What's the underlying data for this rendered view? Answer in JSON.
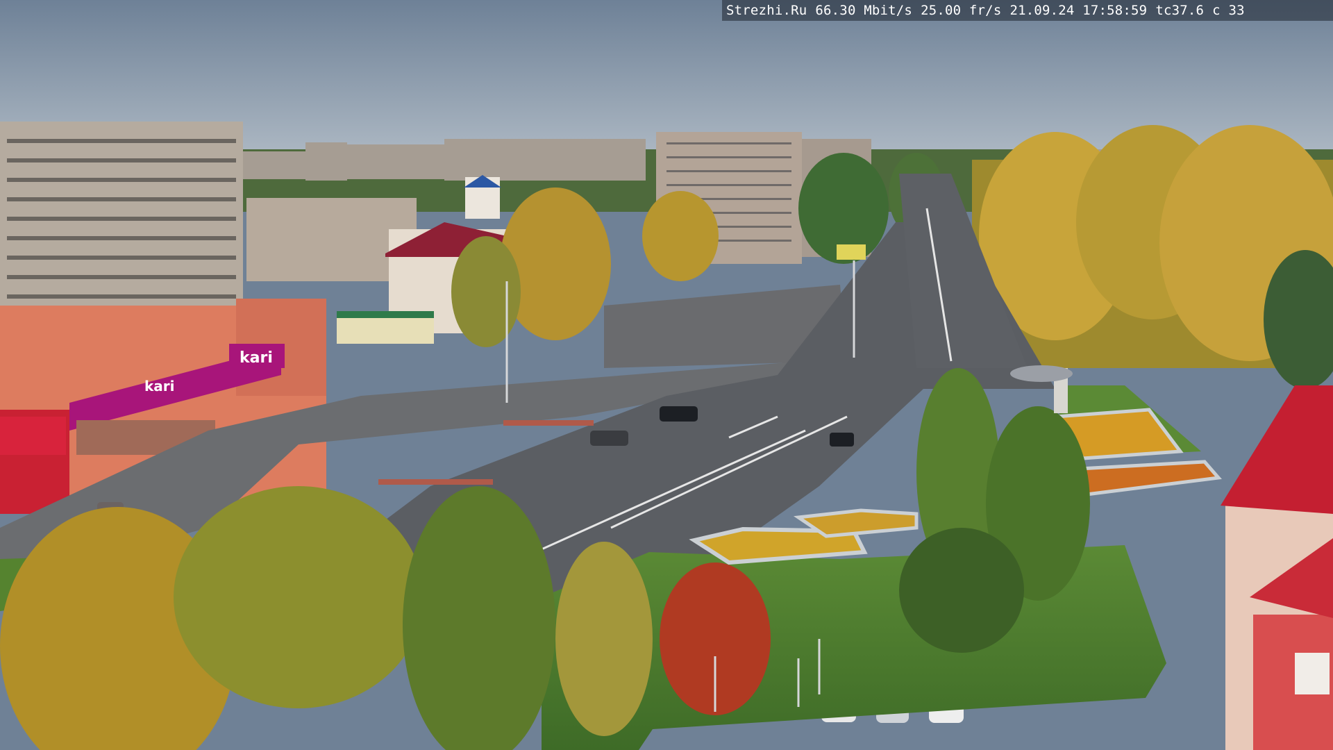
{
  "osd": {
    "site": "Strezhi.Ru",
    "bitrate": "66.30 Mbit/s",
    "framerate": "25.00 fr/s",
    "datetime": "21.09.24 17:58:59",
    "temperature": "tc37.6",
    "extra": "c 33"
  },
  "signs": {
    "store_main": "kari",
    "store_banner": "kari"
  },
  "colors": {
    "sky_top": "#6e8197",
    "sky_bottom": "#a9b6c2",
    "road": "#595c61",
    "plaza": "#64666a",
    "grass": "#4f7d2f",
    "birch_yellow": "#c79f2c",
    "red_maple": "#b03a22",
    "kari_magenta": "#a8157a"
  }
}
